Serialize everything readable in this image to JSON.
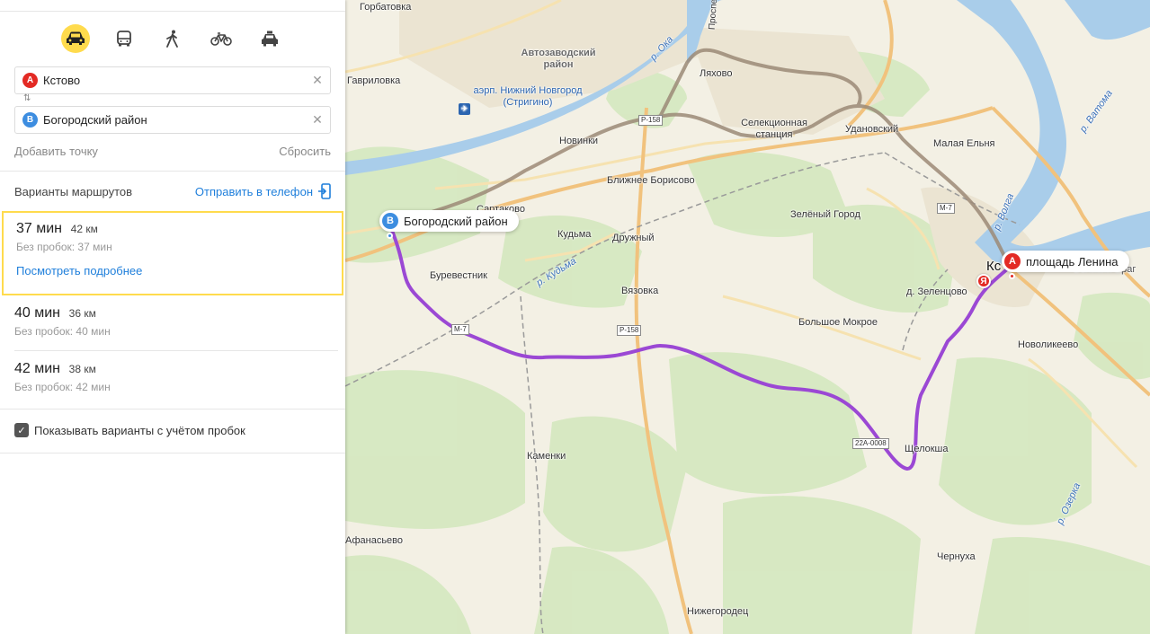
{
  "modes": [
    {
      "name": "car",
      "active": true
    },
    {
      "name": "bus",
      "active": false
    },
    {
      "name": "walk",
      "active": false
    },
    {
      "name": "bike",
      "active": false
    },
    {
      "name": "taxi",
      "active": false
    }
  ],
  "route_form": {
    "from_marker": "A",
    "from_value": "Кстово",
    "to_marker": "B",
    "to_value": "Богородский район",
    "add_point": "Добавить точку",
    "reset": "Сбросить"
  },
  "variants": {
    "title": "Варианты маршрутов",
    "send_to_phone": "Отправить в телефон",
    "items": [
      {
        "time": "37 мин",
        "distance": "42 км",
        "no_traffic": "Без пробок: 37 мин",
        "details": "Посмотреть подробнее"
      },
      {
        "time": "40 мин",
        "distance": "36 км",
        "no_traffic": "Без пробок: 40 мин"
      },
      {
        "time": "42 мин",
        "distance": "38 км",
        "no_traffic": "Без пробок: 42 мин"
      }
    ],
    "traffic_checkbox": "Показывать варианты с учётом пробок"
  },
  "map": {
    "pin_b": {
      "marker": "B",
      "label": "Богородский район"
    },
    "pin_a": {
      "marker": "A",
      "label": "площадь Ленина"
    },
    "ya_marker": "Я",
    "places": [
      "Горбатовка",
      "Гавриловка",
      "Автозаводский район",
      "аэрп. Нижний Новгород (Стригино)",
      "Ляхово",
      "Селекционная станция",
      "Удановский",
      "Малая Ельня",
      "Новинки",
      "Ближнее Борисово",
      "Зелёный Город",
      "Сартаково",
      "Кудьма",
      "Дружный",
      "Буревестник",
      "Вязовка",
      "д. Зеленцово",
      "Большое Мокрое",
      "Новоликеево",
      "Великий Враг",
      "Щелокша",
      "Каменки",
      "Афанасьево",
      "Чернуха",
      "Нижегородец",
      "Кс"
    ],
    "rivers": [
      "р. Ока",
      "р. Ватома",
      "р. Волга",
      "р. Кудьма",
      "р. Озерка"
    ],
    "roads": [
      "Р-158",
      "М-7",
      "М-7",
      "Р-158",
      "22А-0008",
      "Проспект"
    ],
    "colors": {
      "route": "#9b48d4",
      "alt_route": "#9c8a77",
      "water": "#a9cdea",
      "forest": "#d4e8bf"
    }
  }
}
